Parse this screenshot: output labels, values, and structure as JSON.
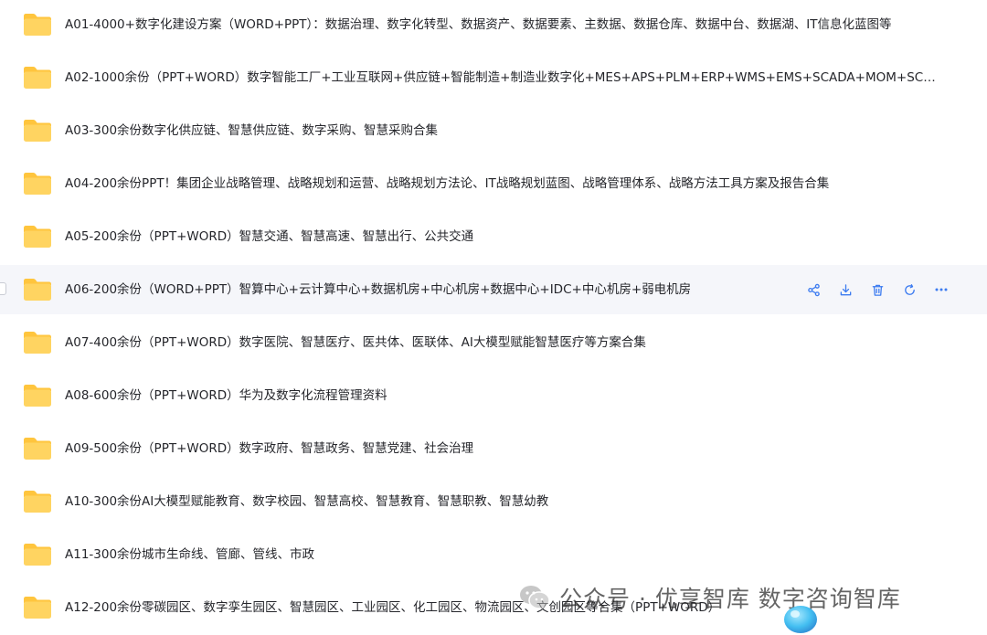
{
  "files": [
    {
      "name": "A01-4000+数字化建设方案（WORD+PPT）：数据治理、数字化转型、数据资产、数据要素、主数据、数据仓库、数据中台、数据湖、IT信息化蓝图等"
    },
    {
      "name": "A02-1000余份（PPT+WORD）数字智能工厂+工业互联网+供应链+智能制造+制造业数字化+MES+APS+PLM+ERP+WMS+EMS+SCADA+MOM+SCM+…"
    },
    {
      "name": "A03-300余份数字化供应链、智慧供应链、数字采购、智慧采购合集"
    },
    {
      "name": "A04-200余份PPT！集团企业战略管理、战略规划和运营、战略规划方法论、IT战略规划蓝图、战略管理体系、战略方法工具方案及报告合集"
    },
    {
      "name": "A05-200余份（PPT+WORD）智慧交通、智慧高速、智慧出行、公共交通"
    },
    {
      "name": "A06-200余份（WORD+PPT）智算中心+云计算中心+数据机房+中心机房+数据中心+IDC+中心机房+弱电机房"
    },
    {
      "name": "A07-400余份（PPT+WORD）数字医院、智慧医疗、医共体、医联体、AI大模型赋能智慧医疗等方案合集"
    },
    {
      "name": "A08-600余份（PPT+WORD）华为及数字化流程管理资料"
    },
    {
      "name": "A09-500余份（PPT+WORD）数字政府、智慧政务、智慧党建、社会治理"
    },
    {
      "name": "A10-300余份AI大模型赋能教育、数字校园、智慧高校、智慧教育、智慧职教、智慧幼教"
    },
    {
      "name": "A11-300余份城市生命线、管廊、管线、市政"
    },
    {
      "name": "A12-200余份零碳园区、数字孪生园区、智慧园区、工业园区、化工园区、物流园区、文创园区等合集（PPT+WORD）"
    }
  ],
  "hovered_row_index": 5,
  "row_actions": [
    {
      "name": "share-icon"
    },
    {
      "name": "download-icon"
    },
    {
      "name": "delete-icon"
    },
    {
      "name": "refresh-icon"
    },
    {
      "name": "more-icon"
    }
  ],
  "watermark": {
    "text": "公众号 · 优享智库 数字咨询智库"
  },
  "colors": {
    "folder_body": "#ffd461",
    "folder_tab": "#ffc53d",
    "action_icon": "#3d7cf0",
    "hover_background": "#f5f6fa"
  }
}
